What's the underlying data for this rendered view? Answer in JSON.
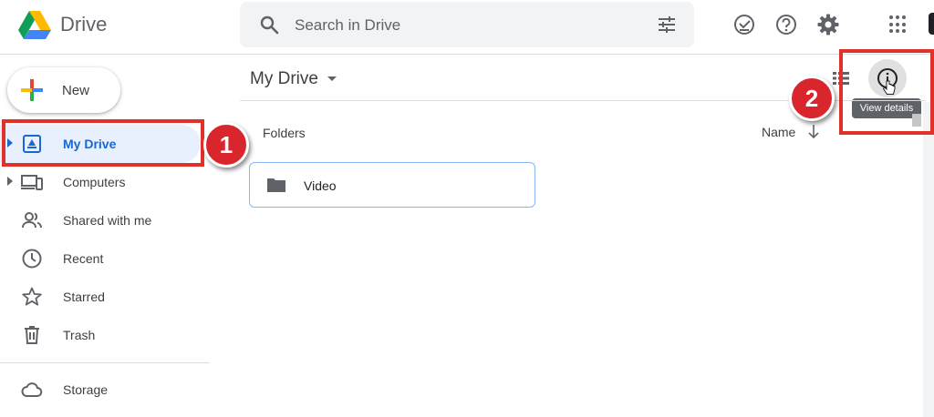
{
  "header": {
    "brand": "Drive",
    "search_placeholder": "Search in Drive",
    "icons": [
      "drive-logo-icon",
      "search-icon",
      "tune-icon",
      "ready-for-offline-icon",
      "help-icon",
      "settings-icon",
      "apps-grid-icon"
    ]
  },
  "sidebar": {
    "new_label": "New",
    "items": [
      {
        "label": "My Drive",
        "icon": "my-drive-icon",
        "active": true,
        "expandable": true
      },
      {
        "label": "Computers",
        "icon": "computers-icon",
        "active": false,
        "expandable": true
      },
      {
        "label": "Shared with me",
        "icon": "shared-icon",
        "active": false,
        "expandable": false
      },
      {
        "label": "Recent",
        "icon": "clock-icon",
        "active": false,
        "expandable": false
      },
      {
        "label": "Starred",
        "icon": "star-icon",
        "active": false,
        "expandable": false
      },
      {
        "label": "Trash",
        "icon": "trash-icon",
        "active": false,
        "expandable": false
      }
    ],
    "storage_label": "Storage"
  },
  "main": {
    "breadcrumb": "My Drive",
    "section_title": "Folders",
    "sort_label": "Name",
    "folders": [
      {
        "name": "Video"
      }
    ],
    "tooltip": "View details"
  },
  "annotations": {
    "step1": "1",
    "step2": "2",
    "highlight_color": "#e0312a"
  },
  "colors": {
    "accent": "#1967d2",
    "active_bg": "#e8f0fe",
    "search_bg": "#f1f3f4"
  }
}
